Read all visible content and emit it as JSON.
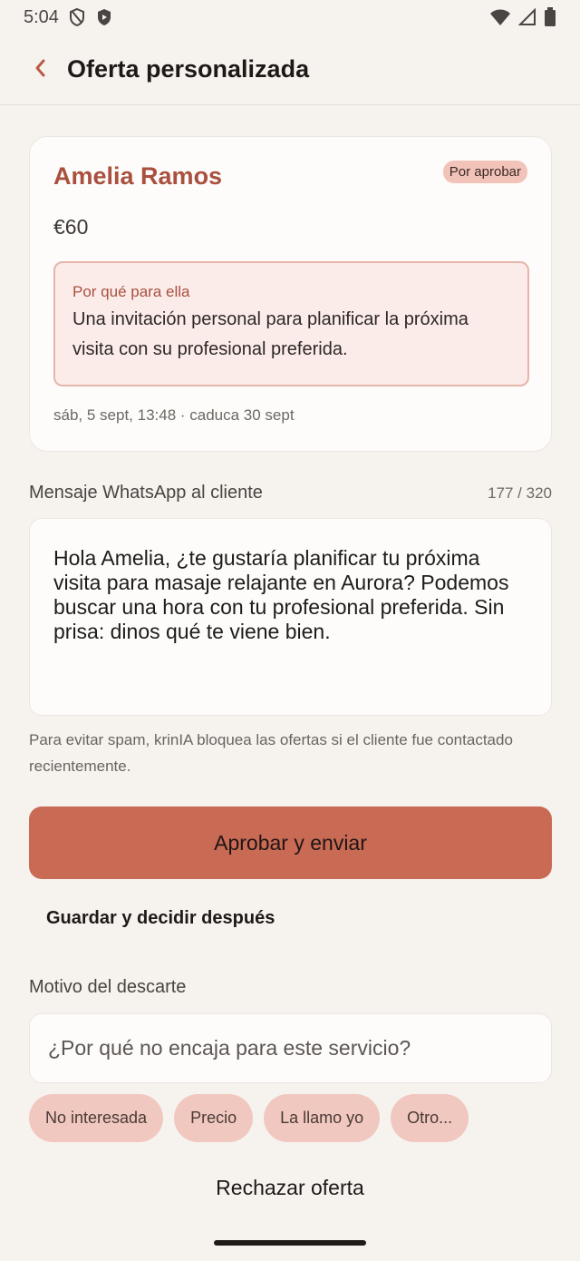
{
  "status_bar": {
    "time": "5:04",
    "icons_left": [
      "shield-outline-icon",
      "shield-filled-icon"
    ],
    "icons_right": [
      "wifi-icon",
      "signal-icon",
      "battery-icon"
    ]
  },
  "app_bar": {
    "back_icon": "chevron-left-icon",
    "title": "Oferta personalizada"
  },
  "offer_card": {
    "client_name": "Amelia Ramos",
    "status_badge": "Por aprobar",
    "price": "€60",
    "reason_title": "Por qué para ella",
    "reason_text": "Una invitación personal para planificar la próxima visita con su profesional preferida.",
    "meta": "sáb, 5 sept, 13:48 · caduca 30 sept"
  },
  "message": {
    "label": "Mensaje WhatsApp al cliente",
    "counter": "177 / 320",
    "text": "Hola Amelia, ¿te gustaría planificar tu próxima visita para masaje relajante en Aurora? Podemos buscar una hora con tu profesional preferida. Sin prisa: dinos qué te viene bien."
  },
  "spam_note": "Para evitar spam, krinIA bloquea las ofertas si el cliente fue contactado recientemente.",
  "actions": {
    "approve_label": "Aprobar y enviar",
    "save_label": "Guardar y decidir después"
  },
  "discard": {
    "label": "Motivo del descarte",
    "placeholder": "¿Por qué no encaja para este servicio?",
    "chips": [
      "No interesada",
      "Precio",
      "La llamo yo",
      "Otro..."
    ],
    "reject_label": "Rechazar oferta"
  },
  "colors": {
    "accent": "#c96a55",
    "name": "#a9503f",
    "badge_bg": "#f2c3b8",
    "chip_bg": "#f0c8bf",
    "background": "#f6f3ef"
  }
}
